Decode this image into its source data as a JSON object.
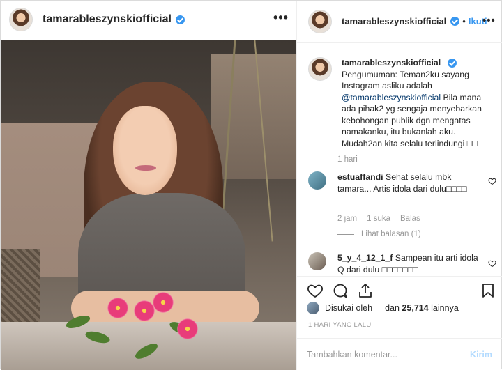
{
  "post": {
    "username": "tamarableszynskiofficial",
    "follow_label": "Ikuti",
    "separator": "•",
    "caption_text_before": "Pengumuman: Teman2ku sayang Instagram asliku adalah ",
    "caption_mention": "@tamarableszynskiofficial",
    "caption_text_after": " Bila mana ada pihak2 yg sengaja menyebarkan kebohongan publik dgn mengatas namakanku, itu bukanlah aku. Mudah2an kita selalu terlindungi □□",
    "caption_time": "1 hari"
  },
  "comments": [
    {
      "username": "estuaffandi",
      "text": "Sehat selalu mbk tamara... Artis idola dari dulu□□□□",
      "time": "2 jam",
      "likes": "1 suka",
      "reply_label": "Balas",
      "view_replies": "Lihat balasan (1)"
    },
    {
      "username": "5_y_4_12_1_f",
      "text": "Sampean itu arti idola Q dari dulu □□□□□□□"
    }
  ],
  "footer": {
    "liked_by_label": "Disukai oleh",
    "liked_by_user": "",
    "and_label": "dan",
    "like_count": "25,714",
    "others_label": "lainnya",
    "post_date": "1 HARI YANG LALU",
    "comment_placeholder": "Tambahkan komentar...",
    "post_button": "Kirim"
  },
  "colors": {
    "link_blue": "#3897f0",
    "mention_blue": "#003569",
    "muted_gray": "#999999",
    "disabled_blue": "#b3dbff"
  }
}
